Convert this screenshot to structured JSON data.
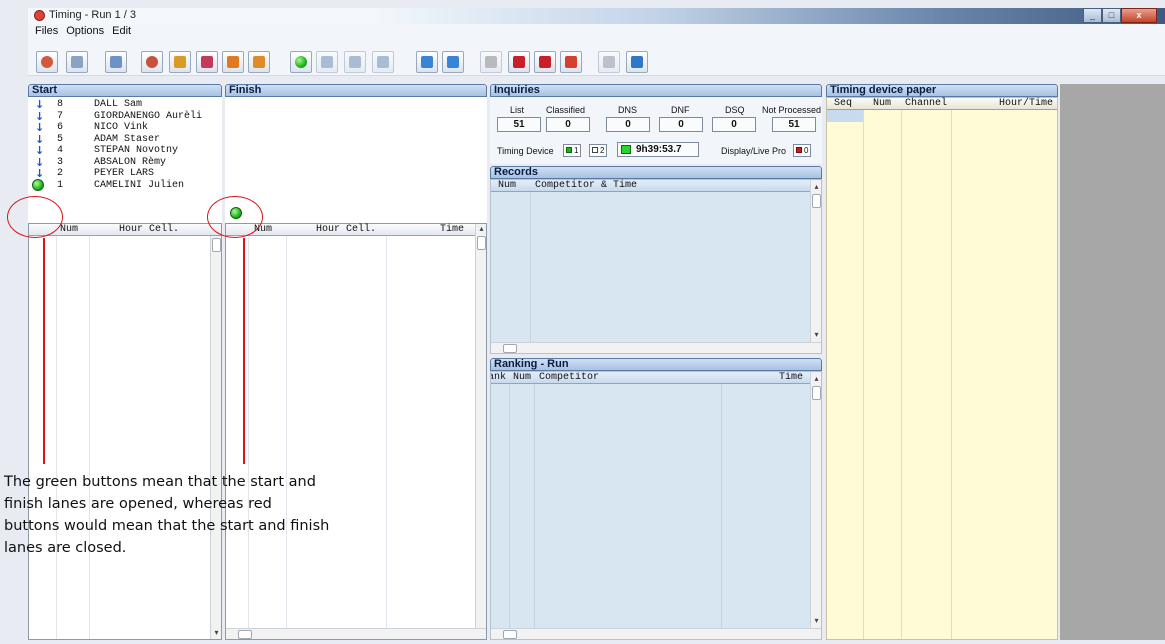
{
  "window": {
    "title": "Timing -  Run 1 / 3"
  },
  "menu": {
    "files": "Files",
    "options": "Options",
    "edit": "Edit"
  },
  "toolbar_buttons": [
    "person-icon",
    "list-icon",
    "columns-icon",
    "reset-icon",
    "flag-icon",
    "remove-flag-icon",
    "doc-icon",
    "doc-check-icon",
    "green-start-icon",
    "time-tick-icon",
    "time-cross-icon",
    "time-plus-icon",
    "arrow-up-blue-icon",
    "arrow-up-num-icon",
    "dns-icon",
    "dnf-icon",
    "dsq-icon",
    "remove-person-icon",
    "search-icon",
    "info-icon"
  ],
  "start": {
    "title": "Start",
    "competitors": [
      {
        "num": "8",
        "name": "DALL Sam"
      },
      {
        "num": "7",
        "name": "GIORDANENGO Aurèli"
      },
      {
        "num": "6",
        "name": "NICO Vink"
      },
      {
        "num": "5",
        "name": "ADAM Staser"
      },
      {
        "num": "4",
        "name": "STEPAN Novotny"
      },
      {
        "num": "3",
        "name": "ABSALON Rèmy"
      },
      {
        "num": "2",
        "name": "PEYER LARS"
      },
      {
        "num": "1",
        "name": "CAMELINI Julien"
      }
    ],
    "grid_cols": {
      "num": "Num",
      "hour": "Hour Cell."
    }
  },
  "finish": {
    "title": "Finish",
    "grid_cols": {
      "num": "Num",
      "hour": "Hour Cell.",
      "time": "Time"
    }
  },
  "inquiries": {
    "title": "Inquiries",
    "labels": {
      "list": "List",
      "classified": "Classified",
      "dns": "DNS",
      "dnf": "DNF",
      "dsq": "DSQ",
      "not_processed": "Not Processed"
    },
    "values": {
      "list": "51",
      "classified": "0",
      "dns": "0",
      "dnf": "0",
      "dsq": "0",
      "not_processed": "51"
    },
    "timing_device_label": "Timing Device",
    "device1": "1",
    "device2": "2",
    "device_time": "9h39:53.7",
    "display_label": "Display/Live Pro",
    "display_value": "0"
  },
  "records": {
    "title": "Records",
    "cols": {
      "num": "Num",
      "competitor": "Competitor & Time"
    }
  },
  "ranking": {
    "title": "Ranking - Run",
    "cols": {
      "rank": "Rank",
      "num": "Num",
      "competitor": "Competitor",
      "time": "Time"
    }
  },
  "timing_paper": {
    "title": "Timing device paper",
    "cols": {
      "seq": "Seq",
      "num": "Num",
      "channel": "Channel",
      "hour": "Hour/Time"
    }
  },
  "annotation": {
    "line1": "The green buttons mean that the start and",
    "line2": "finish lanes are opened, whereas red",
    "line3": "buttons would mean that the start and finish",
    "line4": "lanes are closed."
  },
  "colors": {
    "annotation_red": "#d8141b",
    "panel_blue": "#d8e6f2",
    "paper_yellow": "#fffbd6",
    "lane_open_green": "#24c020"
  }
}
